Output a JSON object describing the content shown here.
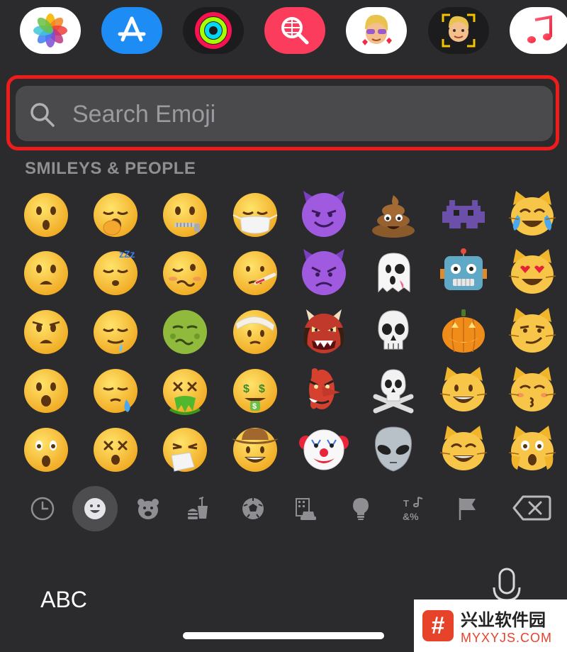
{
  "app_strip": [
    {
      "name": "photos-app",
      "icon": "photos-icon",
      "bg": "#ffffff"
    },
    {
      "name": "app-store-app",
      "icon": "app-store-icon",
      "bg": "#1d8cf4"
    },
    {
      "name": "activity-app",
      "icon": "activity-rings-icon",
      "bg": "#1c1c1e"
    },
    {
      "name": "images-search-app",
      "icon": "web-image-search-icon",
      "bg": "#fc3c5c"
    },
    {
      "name": "memoji-stickers-app",
      "icon": "memoji-sticker-icon",
      "bg": "#ffffff"
    },
    {
      "name": "animoji-app",
      "icon": "animoji-icon",
      "bg": "#1c1c1e"
    },
    {
      "name": "music-app",
      "icon": "music-note-icon",
      "bg": "#ffffff"
    }
  ],
  "search": {
    "placeholder": "Search Emoji",
    "value": ""
  },
  "section_title": "SMILEYS & PEOPLE",
  "emoji_rows": [
    [
      "hushed-face",
      "yawning-face",
      "zipper-mouth-face",
      "face-with-medical-mask",
      "smiling-face-with-horns",
      "pile-of-poo",
      "alien-monster",
      "cat-with-tears-of-joy"
    ],
    [
      "frowning-face-with-open-mouth",
      "sleeping-face",
      "woozy-face",
      "face-with-thermometer",
      "angry-face-with-horns",
      "ghost",
      "robot",
      "smiling-cat-with-heart-eyes"
    ],
    [
      "anguished-face",
      "drooling-face",
      "nauseated-face",
      "face-with-head-bandage",
      "ogre",
      "skull",
      "jack-o-lantern",
      "cat-with-wry-smile"
    ],
    [
      "face-with-open-mouth",
      "sleepy-face",
      "face-vomiting",
      "money-mouth-face",
      "goblin",
      "skull-and-crossbones",
      "grinning-cat",
      "kissing-cat"
    ],
    [
      "astonished-face",
      "dizzy-face",
      "sneezing-face",
      "cowboy-hat-face",
      "clown-face",
      "alien",
      "grinning-cat-with-smiling-eyes",
      "weary-cat"
    ]
  ],
  "categories": [
    {
      "name": "recent",
      "icon": "clock-icon",
      "selected": false
    },
    {
      "name": "smileys-people",
      "icon": "smiley-icon",
      "selected": true
    },
    {
      "name": "animals-nature",
      "icon": "bear-icon",
      "selected": false
    },
    {
      "name": "food-drink",
      "icon": "burger-cup-icon",
      "selected": false
    },
    {
      "name": "activity",
      "icon": "soccer-ball-icon",
      "selected": false
    },
    {
      "name": "travel-places",
      "icon": "building-car-icon",
      "selected": false
    },
    {
      "name": "objects",
      "icon": "lightbulb-icon",
      "selected": false
    },
    {
      "name": "symbols",
      "icon": "symbols-icon",
      "selected": false
    },
    {
      "name": "flags",
      "icon": "flag-icon",
      "selected": false
    }
  ],
  "keys": {
    "abc_label": "ABC"
  },
  "watermark": {
    "logo_glyph": "#",
    "brand_cn": "兴业软件园",
    "url": "MYXYJS.COM"
  },
  "colors": {
    "background": "#2b2b2d",
    "search_field": "#4a4a4d",
    "placeholder": "#9a9a9f",
    "highlight": "#ef1c1c",
    "section_title": "#8e8e93",
    "category_icon": "#8e8e93",
    "category_selected_bg": "#4d4d50"
  }
}
